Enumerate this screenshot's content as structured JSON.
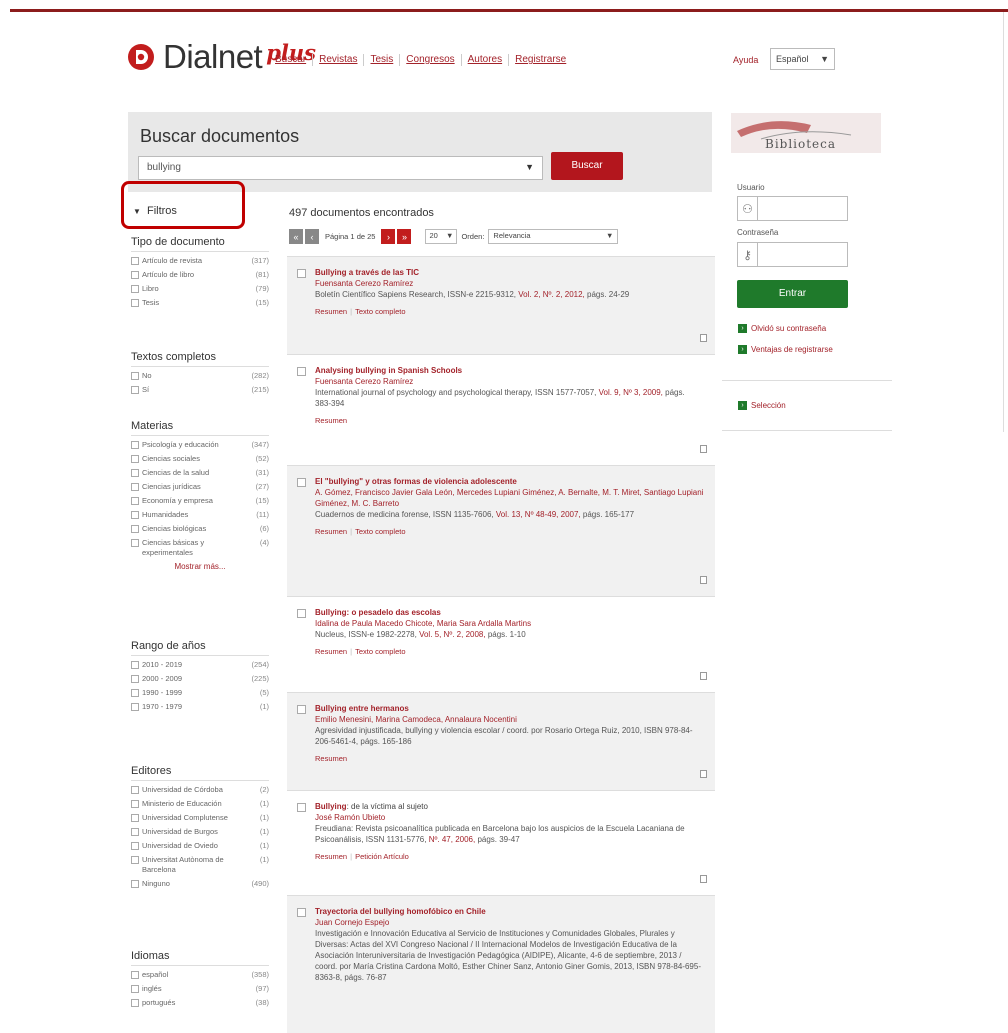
{
  "brand": {
    "name": "Dialnet",
    "plus": "plus",
    "accent": "#a3222a"
  },
  "nav": [
    "Buscar",
    "Revistas",
    "Tesis",
    "Congresos",
    "Autores",
    "Registrarse"
  ],
  "header": {
    "help": "Ayuda",
    "language": "Español"
  },
  "search": {
    "title": "Buscar documentos",
    "query": "bullying",
    "button": "Buscar"
  },
  "filters": {
    "title": "Filtros",
    "groups": [
      {
        "title": "Tipo de documento",
        "items": [
          {
            "label": "Artículo de revista",
            "count": "(317)"
          },
          {
            "label": "Artículo de libro",
            "count": "(81)"
          },
          {
            "label": "Libro",
            "count": "(79)"
          },
          {
            "label": "Tesis",
            "count": "(15)"
          }
        ]
      },
      {
        "title": "Textos completos",
        "items": [
          {
            "label": "No",
            "count": "(282)"
          },
          {
            "label": "Sí",
            "count": "(215)"
          }
        ]
      },
      {
        "title": "Materias",
        "items": [
          {
            "label": "Psicología y educación",
            "count": "(347)"
          },
          {
            "label": "Ciencias sociales",
            "count": "(52)"
          },
          {
            "label": "Ciencias de la salud",
            "count": "(31)"
          },
          {
            "label": "Ciencias jurídicas",
            "count": "(27)"
          },
          {
            "label": "Economía y empresa",
            "count": "(15)"
          },
          {
            "label": "Humanidades",
            "count": "(11)"
          },
          {
            "label": "Ciencias biológicas",
            "count": "(6)"
          },
          {
            "label": "Ciencias básicas y experimentales",
            "count": "(4)"
          }
        ],
        "more": "Mostrar más..."
      },
      {
        "title": "Rango de años",
        "items": [
          {
            "label": "2010 - 2019",
            "count": "(254)"
          },
          {
            "label": "2000 - 2009",
            "count": "(225)"
          },
          {
            "label": "1990 - 1999",
            "count": "(5)"
          },
          {
            "label": "1970 - 1979",
            "count": "(1)"
          }
        ]
      },
      {
        "title": "Editores",
        "items": [
          {
            "label": "Universidad de Córdoba",
            "count": "(2)"
          },
          {
            "label": "Ministerio de Educación",
            "count": "(1)"
          },
          {
            "label": "Universidad Complutense",
            "count": "(1)"
          },
          {
            "label": "Universidad de Burgos",
            "count": "(1)"
          },
          {
            "label": "Universidad de Oviedo",
            "count": "(1)"
          },
          {
            "label": "Universitat Autònoma de Barcelona",
            "count": "(1)"
          },
          {
            "label": "Ninguno",
            "count": "(490)"
          }
        ]
      },
      {
        "title": "Idiomas",
        "items": [
          {
            "label": "español",
            "count": "(358)"
          },
          {
            "label": "inglés",
            "count": "(97)"
          },
          {
            "label": "portugués",
            "count": "(38)"
          }
        ]
      }
    ]
  },
  "results": {
    "count_text": "497 documentos encontrados",
    "page_info": "Página 1 de 25",
    "page_size": "20",
    "order_label": "Orden:",
    "order_value": "Relevancia",
    "items": [
      {
        "title": "Bullying a través de las TIC",
        "title_rest": "",
        "authors": "Fuensanta Cerezo Ramírez",
        "source": "Boletín Científico Sapiens Research, ISSN-e 2215-9312,",
        "source_link": "Vol. 2, Nº. 2, 2012,",
        "source_end": " págs. 24-29",
        "links": [
          "Resumen",
          "Texto completo"
        ]
      },
      {
        "title": "Analysing bullying in Spanish Schools",
        "title_rest": "",
        "authors": "Fuensanta Cerezo Ramírez",
        "source": "International journal of psychology and psychological therapy, ISSN 1577-7057,",
        "source_link": "Vol. 9, Nº 3, 2009,",
        "source_end": " págs. 383-394",
        "links": [
          "Resumen"
        ]
      },
      {
        "title": "El \"bullying\" y otras formas de violencia adolescente",
        "title_rest": "",
        "authors": "A. Gómez, Francisco Javier Gala León, Mercedes Lupiani Giménez, A. Bernalte, M. T. Miret, Santiago Lupiani Giménez, M. C. Barreto",
        "source": "Cuadernos de medicina forense, ISSN 1135-7606,",
        "source_link": "Vol. 13, Nº 48-49, 2007,",
        "source_end": " págs. 165-177",
        "links": [
          "Resumen",
          "Texto completo"
        ]
      },
      {
        "title": "Bullying: o pesadelo das escolas",
        "title_rest": "",
        "authors": "Idalina de Paula Macedo Chicote, Maria Sara Ardalla Martins",
        "source": "Nucleus, ISSN-e 1982-2278,",
        "source_link": "Vol. 5, Nº. 2, 2008,",
        "source_end": " págs. 1-10",
        "links": [
          "Resumen",
          "Texto completo"
        ]
      },
      {
        "title": "Bullying entre hermanos",
        "title_rest": "",
        "authors": "Emilio Menesini, Marina Camodeca, Annalaura Nocentini",
        "source": "Agresividad injustificada, bullying y violencia escolar / coord. por Rosario Ortega Ruiz, 2010, ISBN 978-84-206-5461-4,",
        "source_link": "",
        "source_end": " págs. 165-186",
        "links": [
          "Resumen"
        ]
      },
      {
        "title": "Bullying",
        "title_rest": ": de la víctima al sujeto",
        "authors": "José Ramón Ubieto",
        "source": "Freudiana: Revista psicoanalítica publicada en Barcelona bajo los auspicios de la Escuela Lacaniana de Psicoanálisis, ISSN 1131-5776,",
        "source_link": "Nº. 47, 2006,",
        "source_end": " págs. 39-47",
        "links": [
          "Resumen",
          "Petición Artículo"
        ]
      },
      {
        "title": "Trayectoria del bullying homofóbico en Chile",
        "title_rest": "",
        "authors": "Juan Cornejo Espejo",
        "source": "Investigación e Innovación Educativa al Servicio de Instituciones y Comunidades Globales, Plurales y Diversas: Actas del XVI Congreso Nacional / II Internacional Modelos de Investigación Educativa de la Asociación Interuniversitaria de Investigación Pedagógica (AIDIPE), Alicante, 4-6 de septiembre, 2013 / coord. por María Cristina Cardona Moltó,",
        "source_link": "",
        "source_end": " Esther Chiner Sanz, Antonio Giner Gomis, 2013, ISBN 978-84-695-8363-8, págs. 76-87",
        "links": []
      }
    ]
  },
  "sidebar": {
    "logo_text": "Biblioteca",
    "user_label": "Usuario",
    "password_label": "Contraseña",
    "enter_button": "Entrar",
    "forgot_password": "Olvidó su contraseña",
    "register_benefits": "Ventajas de registrarse",
    "selection": "Selección"
  }
}
